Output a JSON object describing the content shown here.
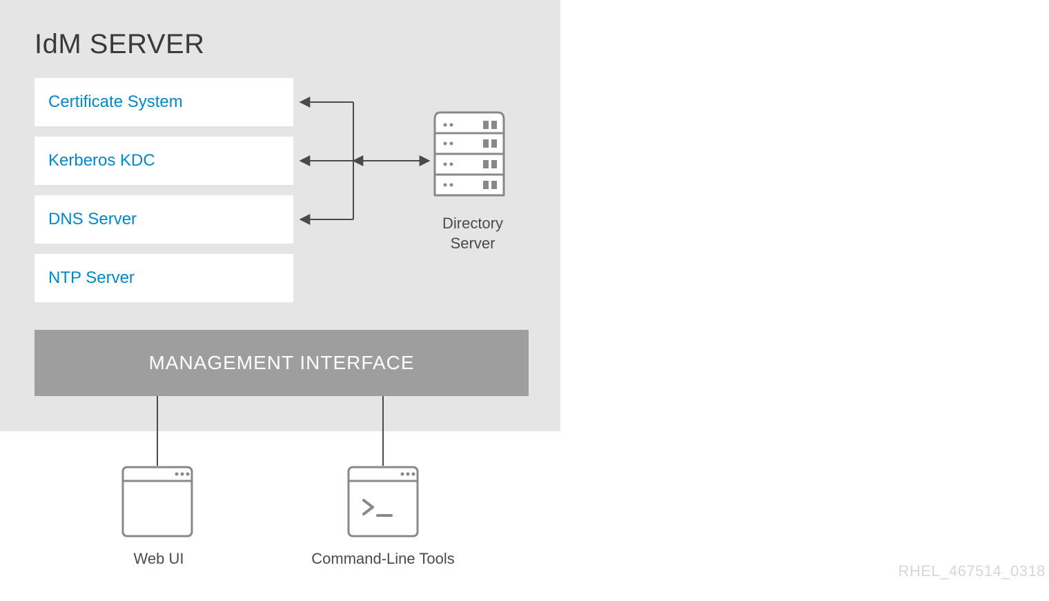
{
  "title": "IdM SERVER",
  "services": [
    "Certificate System",
    "Kerberos KDC",
    "DNS Server",
    "NTP Server"
  ],
  "directory_server_label": "Directory Server",
  "management_label": "MANAGEMENT INTERFACE",
  "clients": {
    "web": "Web UI",
    "cli": "Command-Line Tools"
  },
  "footer_id": "RHEL_467514_0318"
}
